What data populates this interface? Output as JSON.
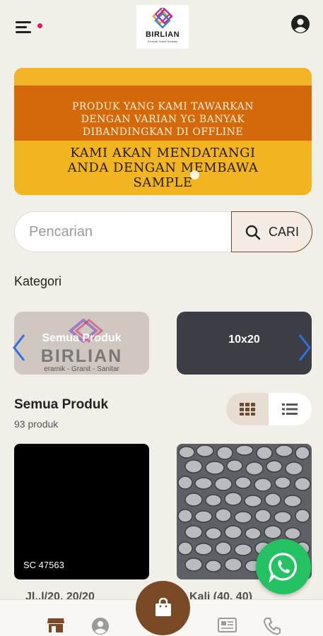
{
  "header": {
    "logo_brand": "BIRLIAN",
    "logo_tagline": "Keramik Granit Sanitary"
  },
  "banner": {
    "line1": "PRODUK YANG KAMI TAWARKAN\nDENGAN VARIAN YG BANYAK\nDIBANDINGKAN DI OFFLINE",
    "line2": "KAMI AKAN MENDATANGI\nANDA DENGAN MEMBAWA\nSAMPLE"
  },
  "search": {
    "placeholder": "Pencarian",
    "button_label": "CARI"
  },
  "categories": {
    "title": "Kategori",
    "items": [
      {
        "label": "Semua Produk",
        "watermark": "BIRLIAN",
        "watermark_sub": "eramik - Granit - Sanitar"
      },
      {
        "label": "10x20"
      }
    ]
  },
  "products": {
    "title": "Semua Produk",
    "count": "93 produk",
    "items": [
      {
        "code": "SC 47563",
        "name": "Jl..l/20, 20/20"
      },
      {
        "code": "",
        "name": "Kali (40, 40)"
      }
    ]
  },
  "colors": {
    "accent_brown": "#7a4a26",
    "whatsapp_green": "#25c263",
    "banner_orange": "#d4690c",
    "banner_yellow": "#f0b521"
  }
}
